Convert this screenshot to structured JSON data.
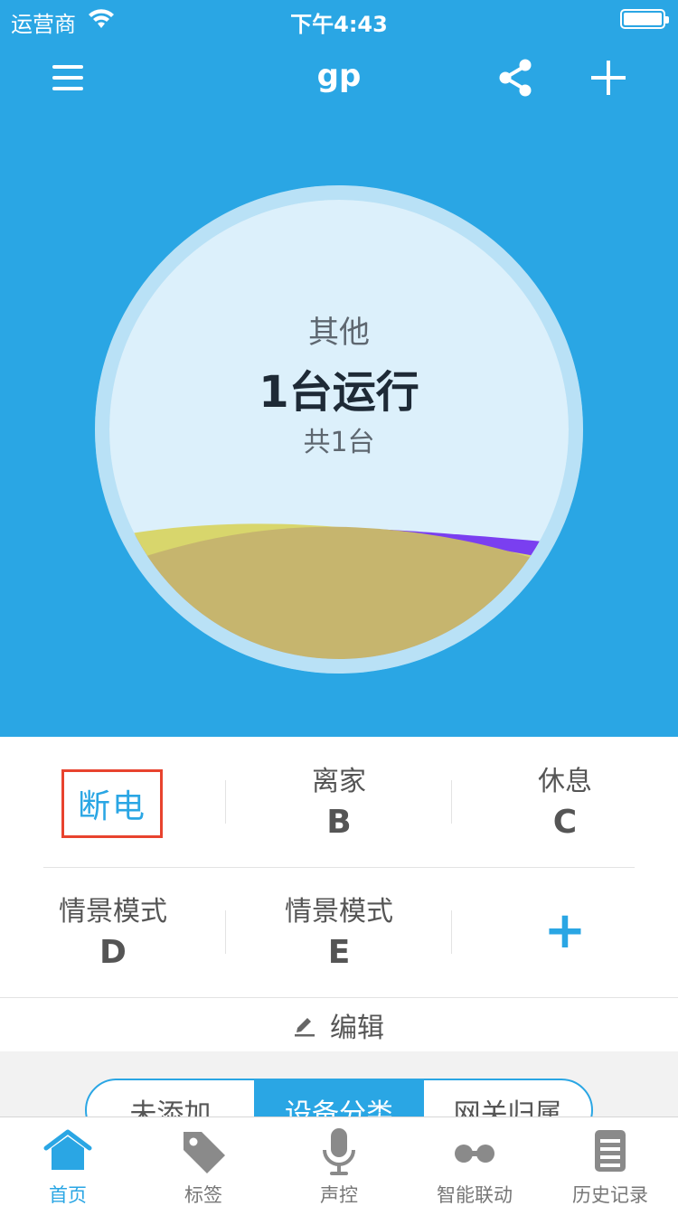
{
  "status_bar": {
    "carrier": "运营商",
    "time": "下午4:43"
  },
  "nav": {
    "title": "gp"
  },
  "gauge": {
    "category": "其他",
    "running": "1台运行",
    "total": "共1台",
    "colors": {
      "outer_ring": "#b9e1f6",
      "inner": "#dcf0fb",
      "wave_yellow": "#d8d66c",
      "wave_purple": "#7a3ff0",
      "wave_brown": "#c6b56e"
    }
  },
  "scenes": {
    "power_off": "断电",
    "items": [
      {
        "title": "离家",
        "letter": "B"
      },
      {
        "title": "休息",
        "letter": "C"
      },
      {
        "title": "情景模式",
        "letter": "D"
      },
      {
        "title": "情景模式",
        "letter": "E"
      }
    ],
    "add_symbol": "+",
    "edit_label": "编辑"
  },
  "segment_tabs": [
    {
      "label": "未添加",
      "active": false
    },
    {
      "label": "设备分类",
      "active": true
    },
    {
      "label": "网关归属",
      "active": false
    }
  ],
  "tabbar": [
    {
      "label": "首页",
      "icon": "home-icon",
      "active": true
    },
    {
      "label": "标签",
      "icon": "tag-icon",
      "active": false
    },
    {
      "label": "声控",
      "icon": "microphone-icon",
      "active": false
    },
    {
      "label": "智能联动",
      "icon": "linkage-icon",
      "active": false
    },
    {
      "label": "历史记录",
      "icon": "history-icon",
      "active": false
    }
  ],
  "colors": {
    "primary": "#2aa6e4",
    "highlight_border": "#e8432e"
  }
}
